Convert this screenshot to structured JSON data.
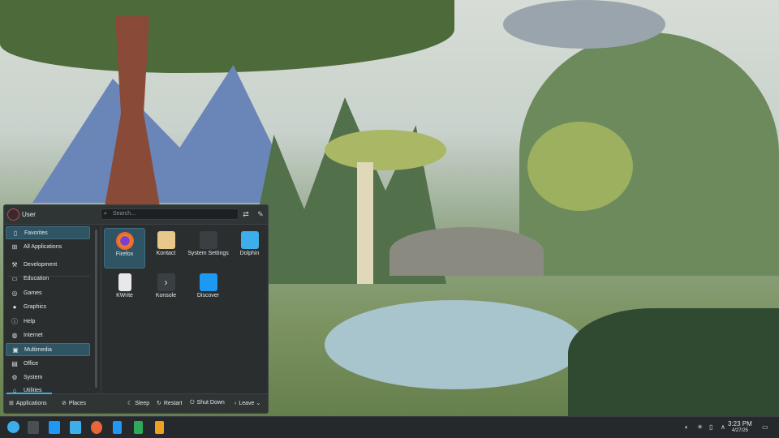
{
  "menu": {
    "user": "User",
    "search_placeholder": "Search...",
    "sidebar": [
      {
        "label": "Favorites",
        "icon": "bookmark-icon",
        "selected": true
      },
      {
        "label": "All Applications",
        "icon": "grid-icon"
      },
      {
        "label": "Development",
        "icon": "wrench-icon"
      },
      {
        "label": "Education",
        "icon": "monitor-icon"
      },
      {
        "label": "Games",
        "icon": "gamepad-icon"
      },
      {
        "label": "Graphics",
        "icon": "palette-icon"
      },
      {
        "label": "Help",
        "icon": "info-icon"
      },
      {
        "label": "Internet",
        "icon": "globe-icon"
      },
      {
        "label": "Multimedia",
        "icon": "multimedia-icon",
        "selected": true
      },
      {
        "label": "Office",
        "icon": "office-icon"
      },
      {
        "label": "System",
        "icon": "gear-icon"
      },
      {
        "label": "Utilities",
        "icon": "utilities-icon"
      }
    ],
    "apps": [
      {
        "label": "Firefox",
        "color": "#e8663a"
      },
      {
        "label": "Kontact",
        "color": "#e8c88a"
      },
      {
        "label": "System Settings",
        "color": "#3a3f44"
      },
      {
        "label": "Dolphin",
        "color": "#3daee9"
      },
      {
        "label": "KWrite",
        "color": "#e8e8e8"
      },
      {
        "label": "Konsole",
        "color": "#3a3f44"
      },
      {
        "label": "Discover",
        "color": "#1d99f3"
      }
    ],
    "footer": {
      "applications": "Applications",
      "places": "Places",
      "sleep": "Sleep",
      "restart": "Restart",
      "shutdown": "Shut Down",
      "leave": "Leave"
    }
  },
  "taskbar": {
    "time": "3:23 PM",
    "date": "4/27/25"
  }
}
